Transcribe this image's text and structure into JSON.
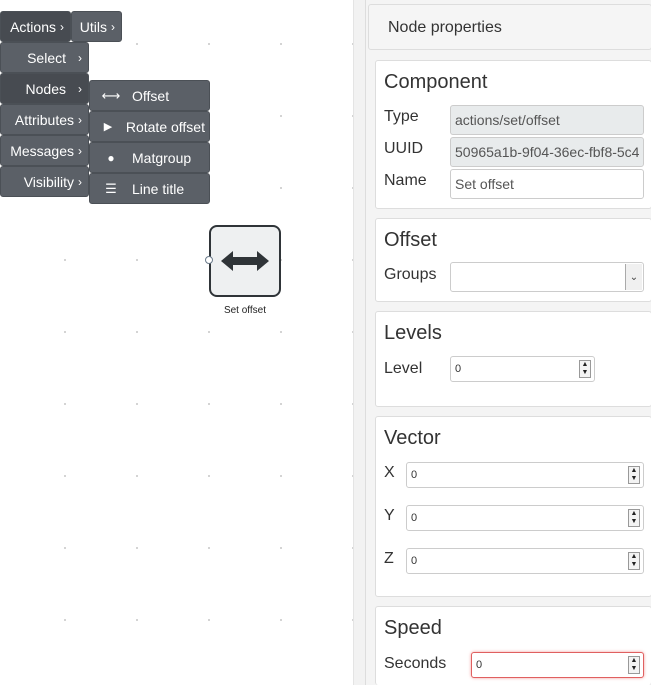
{
  "menu": {
    "primary": [
      {
        "label": "Actions",
        "chevron": "›",
        "active": true
      },
      {
        "label": "Select",
        "chevron": "›",
        "active": false
      },
      {
        "label": "Nodes",
        "chevron": "›",
        "active": true
      },
      {
        "label": "Attributes",
        "chevron": "›",
        "active": false
      },
      {
        "label": "Messages",
        "chevron": "›",
        "active": false
      },
      {
        "label": "Visibility",
        "chevron": "›",
        "active": false
      }
    ],
    "utils": {
      "label": "Utils",
      "chevron": "›"
    },
    "submenu": [
      {
        "label": "Offset",
        "icon": "double-arrow-icon",
        "glyph": "⟷"
      },
      {
        "label": "Rotate offset",
        "icon": "play-icon",
        "glyph": "▶"
      },
      {
        "label": "Matgroup",
        "icon": "globe-icon",
        "glyph": "●"
      },
      {
        "label": "Line title",
        "icon": "list-icon",
        "glyph": "☰"
      }
    ]
  },
  "node": {
    "label": "Set offset",
    "icon": "horizontal-arrows-icon"
  },
  "panel": {
    "title": "Node properties",
    "component": {
      "title": "Component",
      "type_label": "Type",
      "type_value": "actions/set/offset",
      "uuid_label": "UUID",
      "uuid_value": "50965a1b-9f04-36ec-fbf8-5c4",
      "name_label": "Name",
      "name_value": "Set offset"
    },
    "offset": {
      "title": "Offset",
      "groups_label": "Groups",
      "groups_value": ""
    },
    "levels": {
      "title": "Levels",
      "level_label": "Level",
      "level_value": "0"
    },
    "vector": {
      "title": "Vector",
      "x_label": "X",
      "x_value": "0",
      "y_label": "Y",
      "y_value": "0",
      "z_label": "Z",
      "z_value": "0"
    },
    "speed": {
      "title": "Speed",
      "seconds_label": "Seconds",
      "seconds_value": "0"
    }
  },
  "colors": {
    "menu_bg": "#5b6067",
    "menu_active": "#474b51",
    "focus_border": "#e06060"
  }
}
